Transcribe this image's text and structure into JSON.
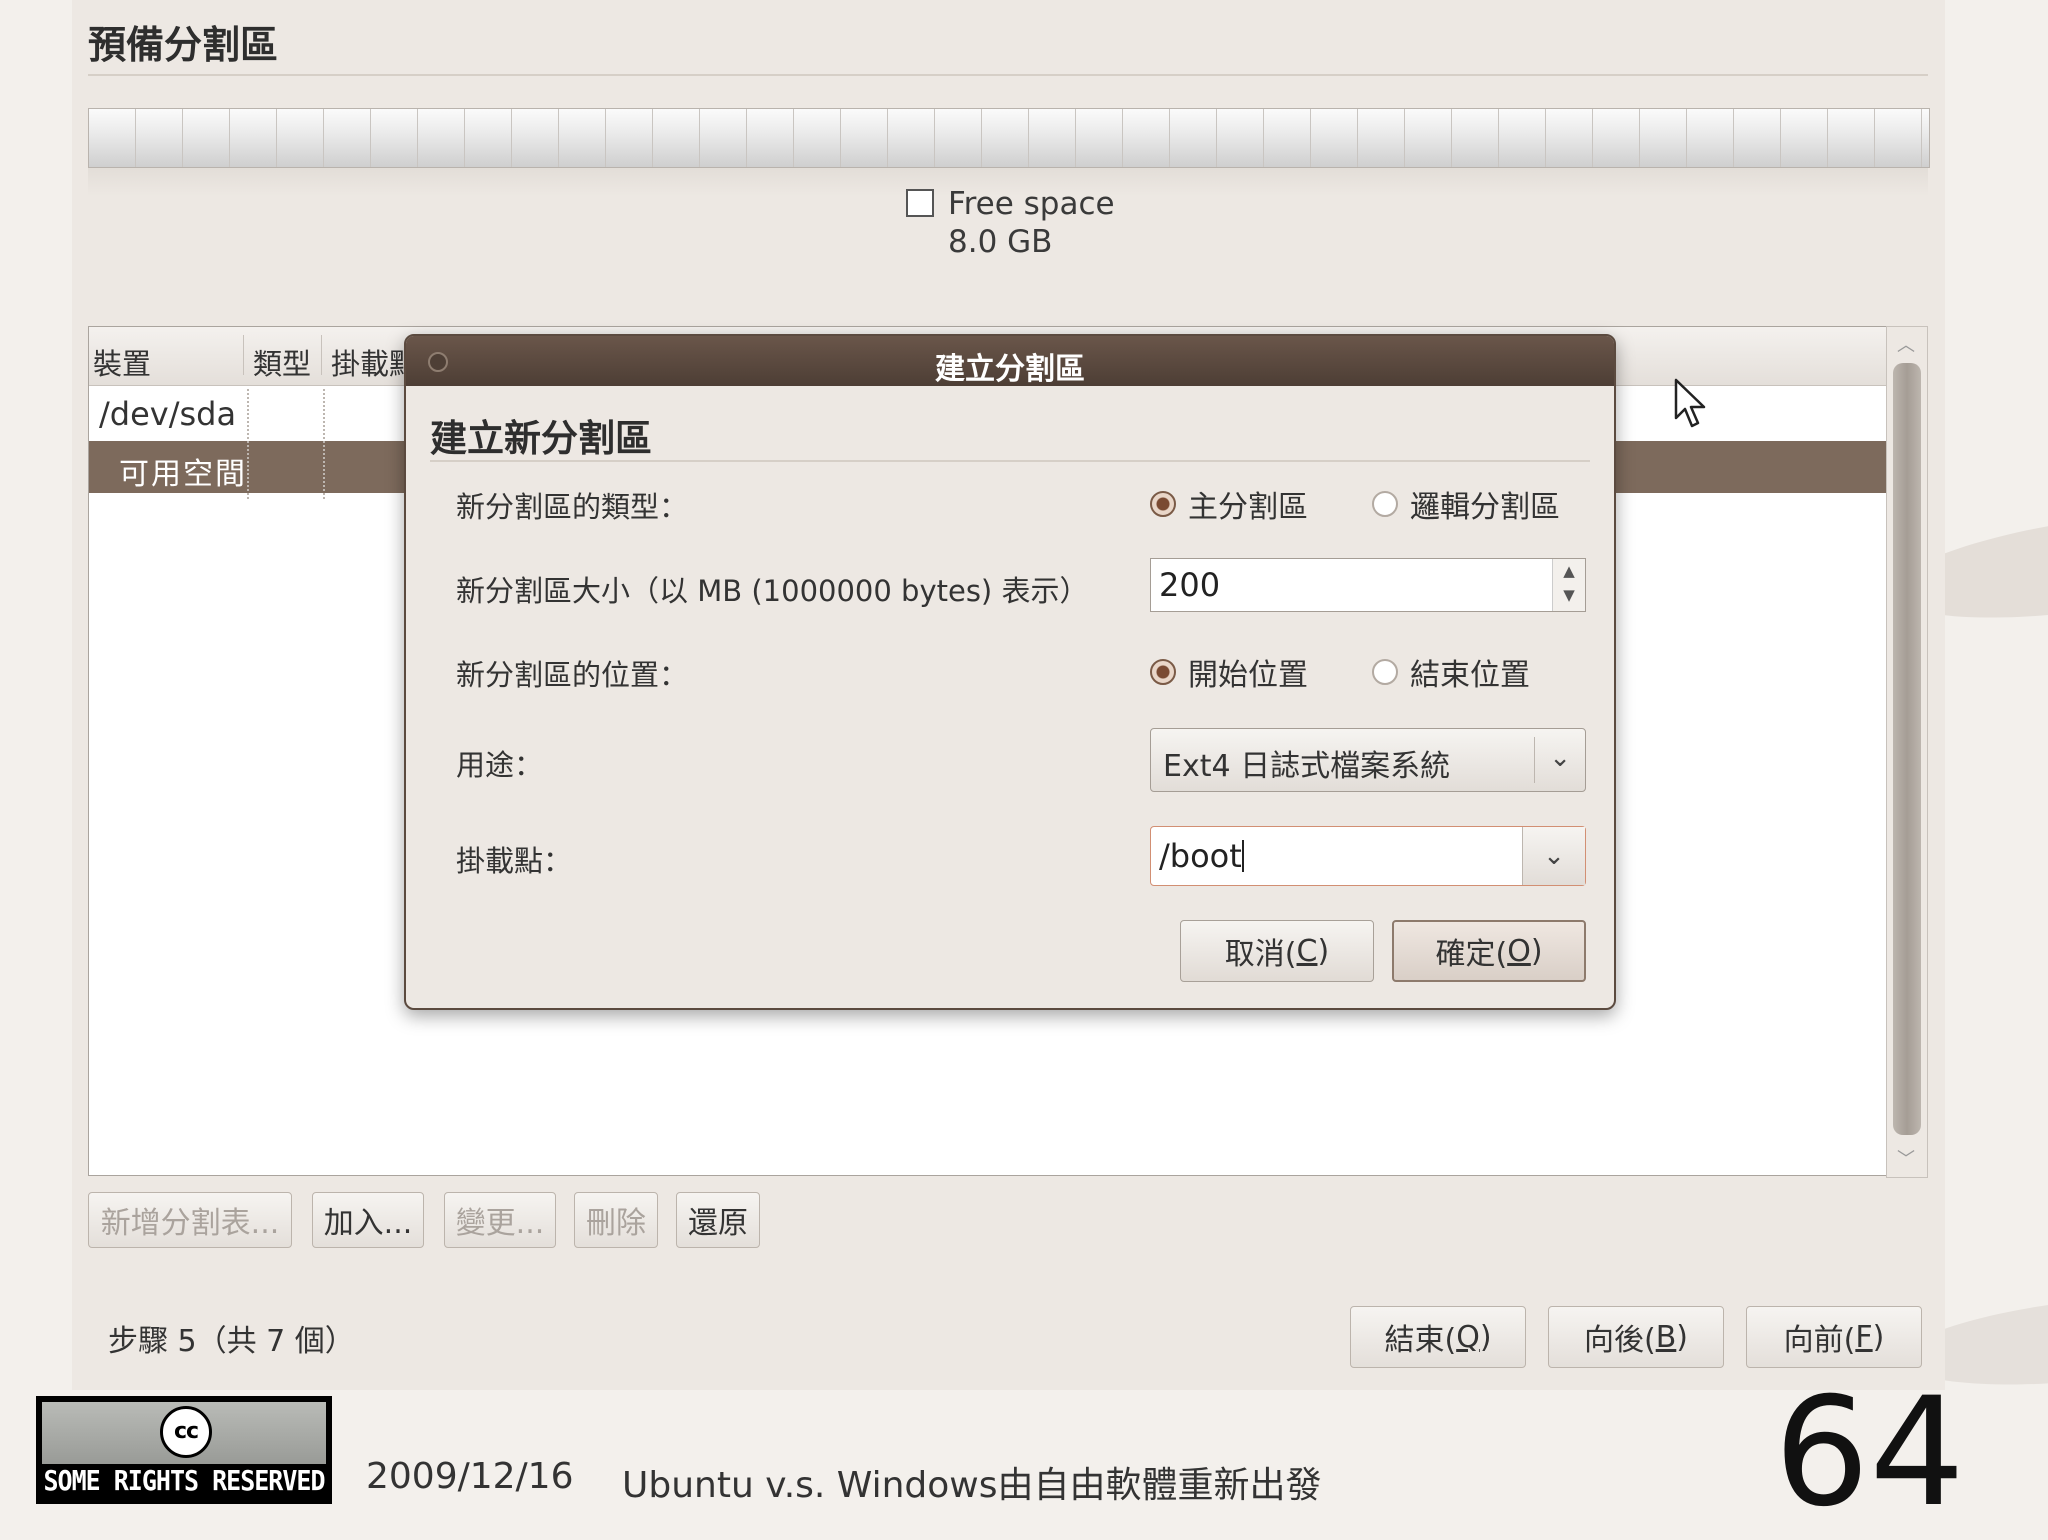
{
  "page": {
    "title": "預備分割區",
    "legend_label": "Free space",
    "legend_size": "8.0 GB"
  },
  "table": {
    "headers": [
      "裝置",
      "類型",
      "掛載點"
    ],
    "rows": [
      {
        "device": "/dev/sda"
      },
      {
        "device": "可用空間",
        "selected": true
      }
    ]
  },
  "toolbar": {
    "new_table": "新增分割表...",
    "add": "加入...",
    "change": "變更...",
    "delete": "刪除",
    "revert": "還原"
  },
  "footer_nav": {
    "step": "步驟 5（共 7 個）",
    "quit_prefix": "結束(",
    "quit_key": "Q",
    "back_prefix": "向後(",
    "back_key": "B",
    "forward_prefix": "向前(",
    "forward_key": "F",
    "suffix": ")"
  },
  "dialog": {
    "title": "建立分割區",
    "heading": "建立新分割區",
    "type_label": "新分割區的類型：",
    "type_primary": "主分割區",
    "type_logical": "邏輯分割區",
    "size_label": "新分割區大小（以 MB (1000000 bytes) 表示）",
    "size_value": "200",
    "location_label": "新分割區的位置：",
    "location_start": "開始位置",
    "location_end": "結束位置",
    "use_label": "用途：",
    "use_value": "Ext4 日誌式檔案系統",
    "mount_label": "掛載點：",
    "mount_value": "/boot",
    "cancel_prefix": "取消(",
    "cancel_key": "C",
    "ok_prefix": "確定(",
    "ok_key": "O",
    "suffix": ")"
  },
  "slide": {
    "license": "SOME RIGHTS RESERVED",
    "license_logo": "cc",
    "date": "2009/12/16",
    "title": "Ubuntu v.s. Windows由自由軟體重新出發",
    "page_number": "64"
  },
  "colors": {
    "accent_brown": "#7d6a5c",
    "title_bar": "#4d3e35"
  }
}
